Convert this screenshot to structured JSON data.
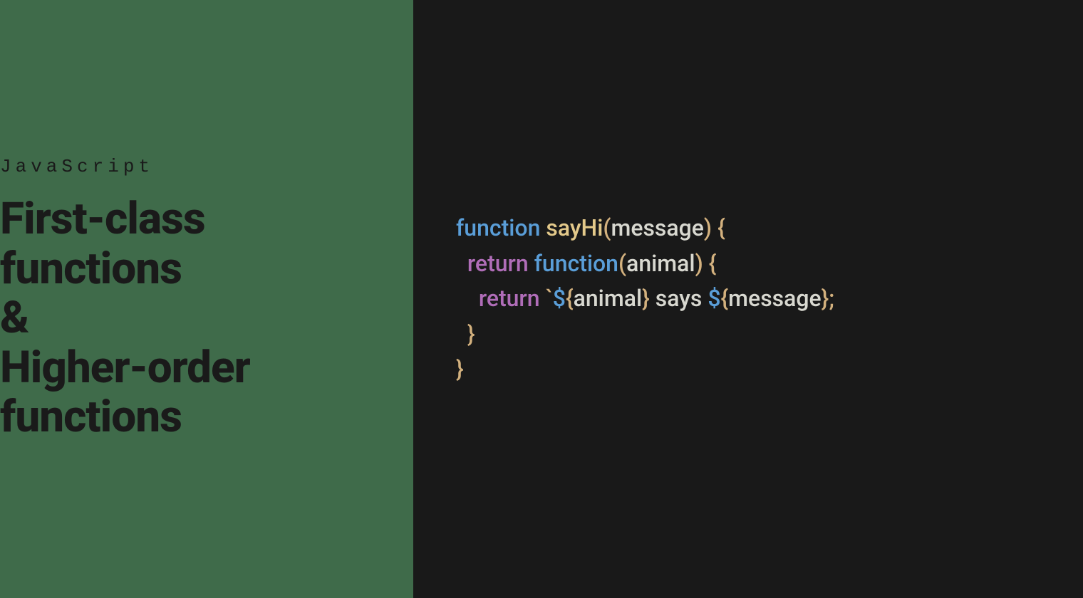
{
  "left": {
    "eyebrow": "JavaScript",
    "title_line1": "First-class",
    "title_line2": "functions",
    "title_line3": "&",
    "title_line4": "Higher-order",
    "title_line5": "functions"
  },
  "code": {
    "line1": {
      "kw_function": "function",
      "space1": " ",
      "name": "sayHi",
      "paren_open": "(",
      "param": "message",
      "paren_close": ")",
      "space2": " ",
      "brace_open": "{"
    },
    "line2": {
      "indent": "  ",
      "kw_return": "return",
      "space1": " ",
      "kw_function": "function",
      "paren_open": "(",
      "param": "animal",
      "paren_close": ")",
      "space2": " ",
      "brace_open": "{"
    },
    "line3": {
      "indent": "    ",
      "kw_return": "return",
      "space1": " ",
      "backtick": "`",
      "dollar1": "$",
      "lbrace1": "{",
      "var1": "animal",
      "rbrace1": "}",
      "text_mid": " says ",
      "dollar2": "$",
      "lbrace2": "{",
      "var2": "message",
      "rbrace2": "}",
      "semi": ";"
    },
    "line4": {
      "indent": "  ",
      "brace_close": "}"
    },
    "line5": {
      "brace_close": "}"
    }
  }
}
